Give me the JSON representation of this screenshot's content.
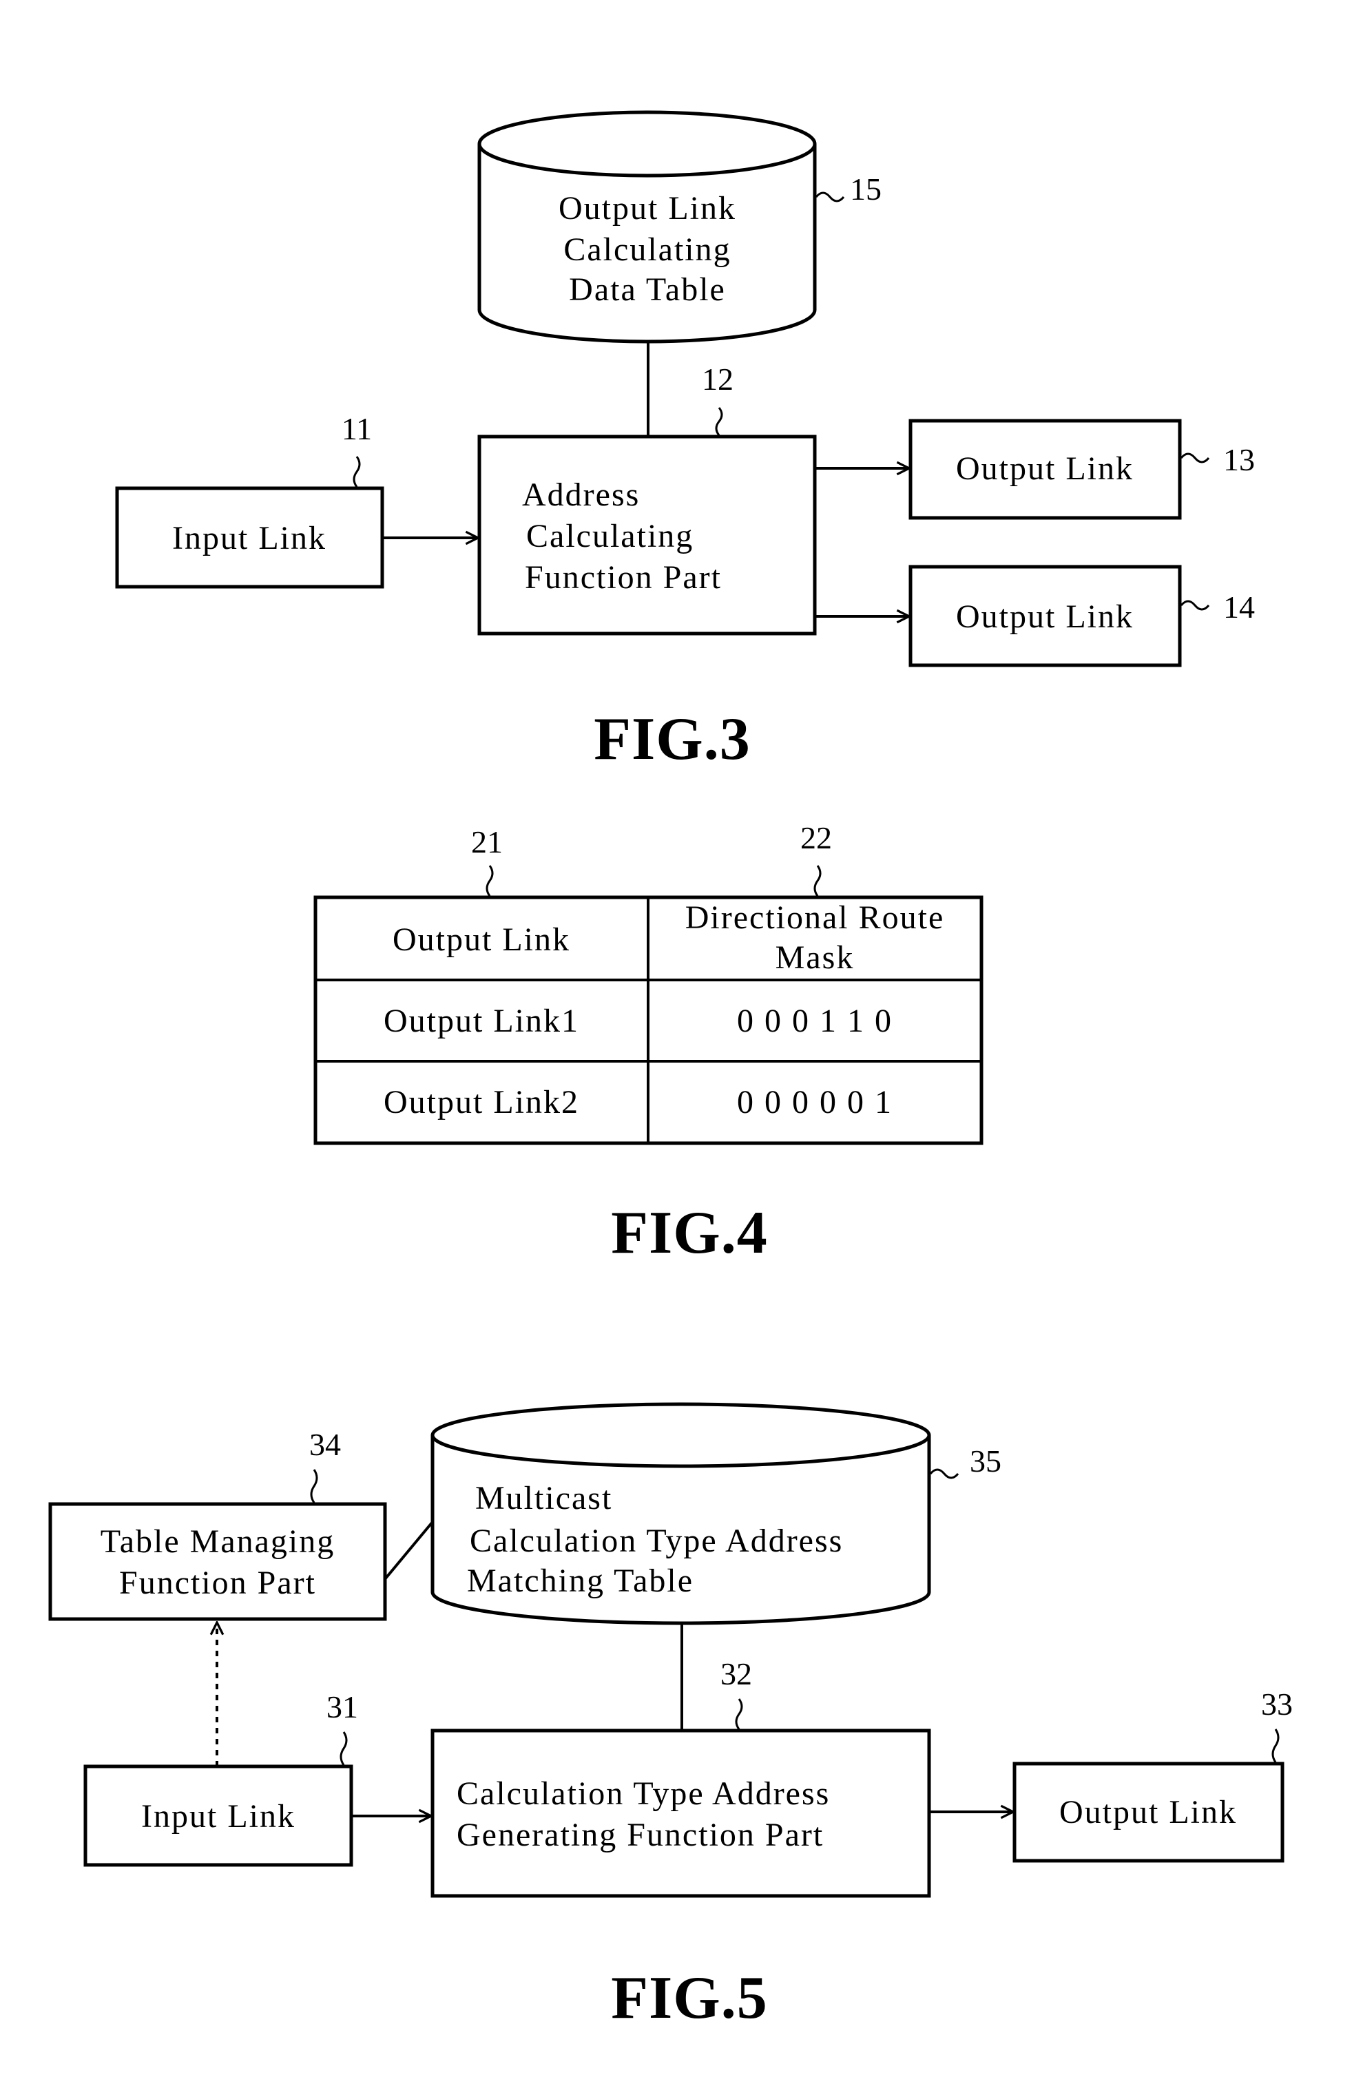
{
  "fig3": {
    "caption": "FIG.3",
    "data_table": {
      "ref": "15",
      "lines": [
        "Output Link",
        "Calculating",
        "Data Table"
      ]
    },
    "address_part": {
      "ref": "12",
      "lines": [
        "Address",
        "Calculating",
        "Function Part"
      ]
    },
    "input_link": {
      "ref": "11",
      "label": "Input Link"
    },
    "output_link_a": {
      "ref": "13",
      "label": "Output Link"
    },
    "output_link_b": {
      "ref": "14",
      "label": "Output Link"
    }
  },
  "fig4": {
    "caption": "FIG.4",
    "col_refs": [
      "21",
      "22"
    ],
    "headers": [
      "Output Link",
      "Directional Route",
      "Mask"
    ],
    "rows": [
      {
        "link": "Output Link1",
        "mask": "0 0 0 1 1 0"
      },
      {
        "link": "Output Link2",
        "mask": "0 0 0 0 0 1"
      }
    ]
  },
  "fig5": {
    "caption": "FIG.5",
    "matching_table": {
      "ref": "35",
      "lines": [
        "Multicast",
        "Calculation Type Address",
        "Matching Table"
      ]
    },
    "table_manager": {
      "ref": "34",
      "lines": [
        "Table Managing",
        "Function Part"
      ]
    },
    "input_link": {
      "ref": "31",
      "label": "Input Link"
    },
    "generator": {
      "ref": "32",
      "lines": [
        "Calculation Type Address",
        "Generating Function Part"
      ]
    },
    "output_link": {
      "ref": "33",
      "label": "Output Link"
    }
  }
}
